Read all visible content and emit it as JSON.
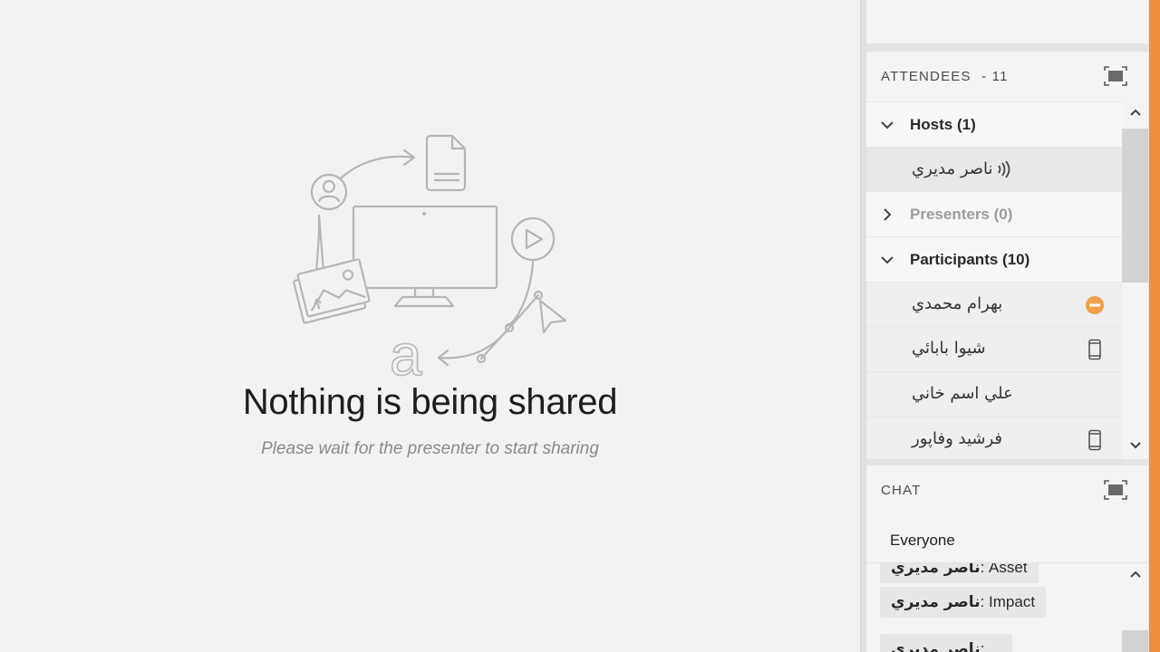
{
  "share": {
    "title": "Nothing is being shared",
    "subtitle": "Please wait for the presenter to start sharing"
  },
  "attendees": {
    "title": "ATTENDEES",
    "count_label": "- 11",
    "groups": {
      "hosts": {
        "label": "Hosts (1)",
        "expanded": true
      },
      "presenters": {
        "label": "Presenters (0)",
        "expanded": false
      },
      "participants": {
        "label": "Participants (10)",
        "expanded": true
      }
    },
    "host_people": [
      {
        "name": "ناصر مديري",
        "icon": "speaking-icon"
      }
    ],
    "participant_people": [
      {
        "name": "بهرام محمدي",
        "icon": "away-status-icon",
        "status_color": "#f0a04b"
      },
      {
        "name": "شيوا بابائي",
        "icon": "mobile-device-icon"
      },
      {
        "name": "علي اسم خاني",
        "icon": ""
      },
      {
        "name": "فرشيد وفاپور",
        "icon": "mobile-device-icon"
      }
    ]
  },
  "chat": {
    "title": "CHAT",
    "recipient": "Everyone",
    "messages": [
      {
        "sender": "ناصر مديري",
        "text": ": Asset"
      },
      {
        "sender": "ناصر مديري",
        "text": ": Impact"
      },
      {
        "sender": "ناصر مديري",
        "text": ": ..."
      }
    ]
  },
  "colors": {
    "accent": "#ef8f3e",
    "away_status": "#f0a04b",
    "background": "#f2f2f2"
  }
}
